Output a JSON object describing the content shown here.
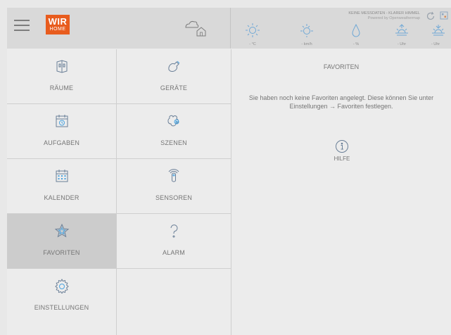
{
  "header": {
    "logo_line1": "WIR",
    "logo_line2": "HOME",
    "logo_color": "#e85c1e",
    "weather_status": "KEINE MESSDATEN - KLARER HIMMEL",
    "weather_source": "Powered by Openweathermap",
    "weather_items": [
      {
        "icon": "sun-icon",
        "value": "- °C"
      },
      {
        "icon": "wind-sun-icon",
        "value": "- km/h"
      },
      {
        "icon": "humidity-drop-icon",
        "value": "- %"
      },
      {
        "icon": "sunrise-icon",
        "value": "- Uhr"
      },
      {
        "icon": "sunset-icon",
        "value": "- Uhr"
      }
    ]
  },
  "sidebar": {
    "items": [
      {
        "label": "RÄUME",
        "icon": "rooms-icon"
      },
      {
        "label": "GERÄTE",
        "icon": "devices-icon"
      },
      {
        "label": "AUFGABEN",
        "icon": "tasks-icon"
      },
      {
        "label": "SZENEN",
        "icon": "scenes-icon"
      },
      {
        "label": "KALENDER",
        "icon": "calendar-icon"
      },
      {
        "label": "SENSOREN",
        "icon": "sensors-icon"
      },
      {
        "label": "FAVORITEN",
        "icon": "star-icon",
        "active": true
      },
      {
        "label": "ALARM",
        "icon": "question-icon"
      },
      {
        "label": "EINSTELLUNGEN",
        "icon": "settings-icon"
      }
    ]
  },
  "main": {
    "title": "FAVORITEN",
    "message": "Sie haben noch keine Favoriten angelegt. Diese können Sie unter Einstellungen → Favoriten festlegen.",
    "help_label": "HILFE"
  }
}
